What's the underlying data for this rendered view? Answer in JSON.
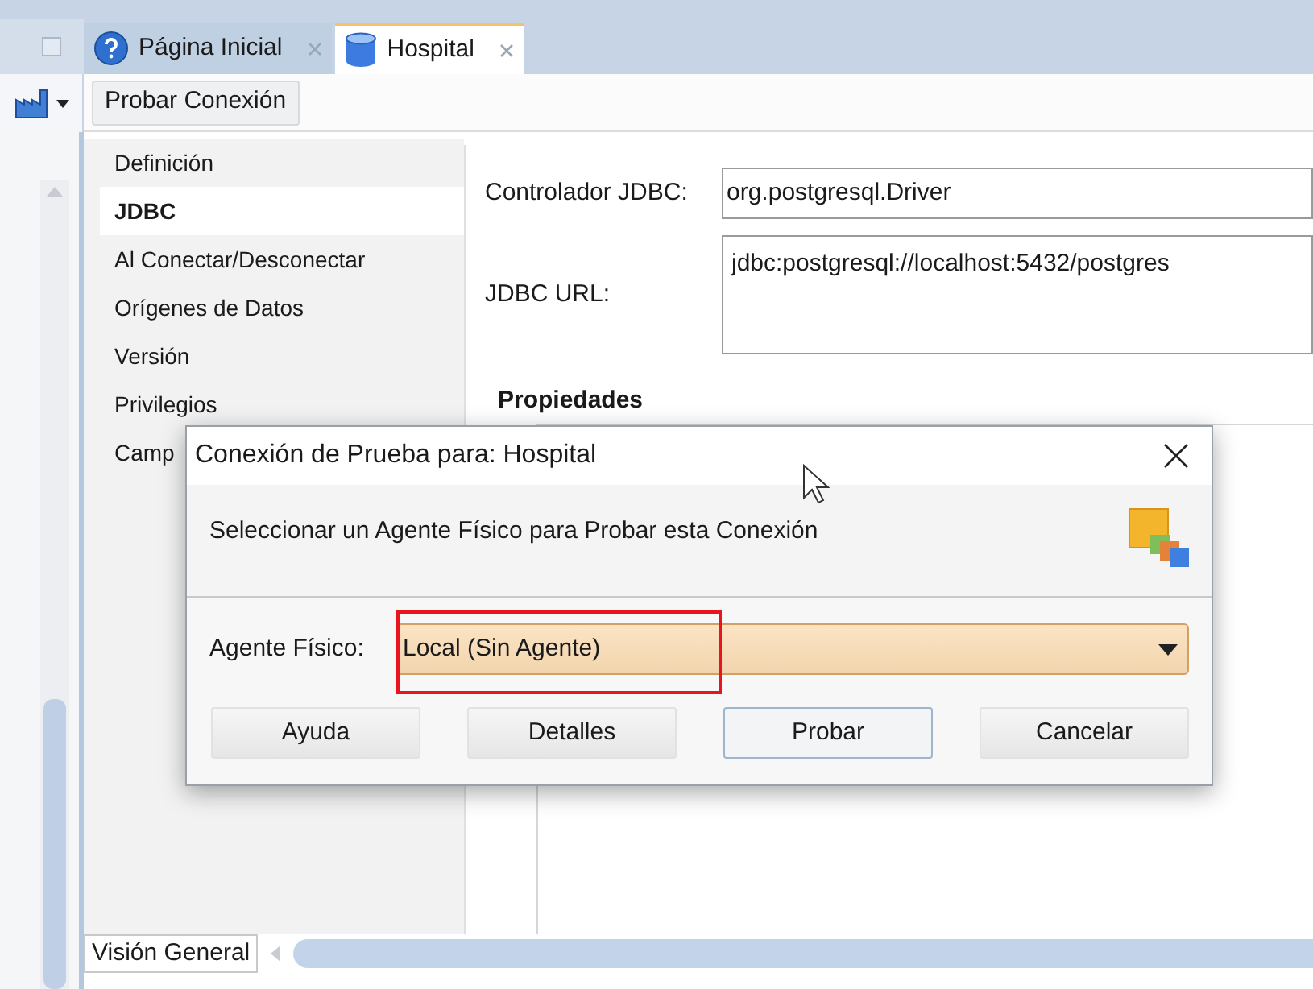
{
  "tabs": [
    {
      "label": "Página Inicial",
      "kind": "help",
      "selected": false
    },
    {
      "label": "Hospital",
      "kind": "database",
      "selected": true
    }
  ],
  "toolbar": {
    "button": "Probar Conexión"
  },
  "nav": {
    "items": [
      {
        "label": "Definición",
        "selected": false
      },
      {
        "label": "JDBC",
        "selected": true
      },
      {
        "label": "Al Conectar/Desconectar",
        "selected": false
      },
      {
        "label": "Orígenes de Datos",
        "selected": false
      },
      {
        "label": "Versión",
        "selected": false
      },
      {
        "label": "Privilegios",
        "selected": false
      },
      {
        "label": "Camp",
        "selected": false
      }
    ]
  },
  "form": {
    "driver_label": "Controlador JDBC:",
    "driver_value": "org.postgresql.Driver",
    "url_label": "JDBC URL:",
    "url_value": "jdbc:postgresql://localhost:5432/postgres",
    "section_title": "Propiedades"
  },
  "dialog": {
    "title": "Conexión de Prueba para: Hospital",
    "subtitle": "Seleccionar un Agente Físico para Probar esta Conexión",
    "agent_label": "Agente Físico:",
    "agent_value": "Local (Sin Agente)",
    "highlighted": true,
    "buttons": [
      {
        "label": "Ayuda",
        "focused": false
      },
      {
        "label": "Detalles",
        "focused": false
      },
      {
        "label": "Probar",
        "focused": true
      },
      {
        "label": "Cancelar",
        "focused": false
      }
    ]
  },
  "bottom_tab": {
    "label": "Visión General"
  }
}
